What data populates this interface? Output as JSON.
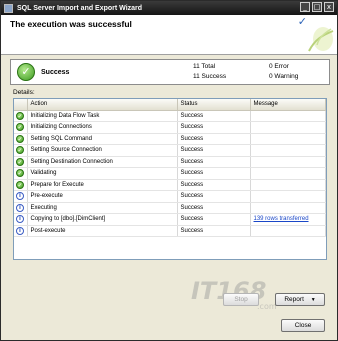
{
  "window": {
    "title": "SQL Server Import and Export Wizard",
    "minimize_glyph": "_",
    "maximize_glyph": "□",
    "close_glyph": "x"
  },
  "header": {
    "heading": "The execution was successful",
    "check_icon": "checkmark-icon",
    "check_glyph": "✓"
  },
  "status": {
    "icon": "success-icon",
    "icon_glyph": "✓",
    "text": "Success",
    "total": "11 Total",
    "success": "11 Success",
    "error": "0 Error",
    "warning": "0 Warning"
  },
  "details": {
    "label": "Details:",
    "columns": {
      "action": "Action",
      "status": "Status",
      "message": "Message"
    },
    "rows": [
      {
        "icon": "success",
        "action": "Initializing Data Flow Task",
        "status": "Success",
        "message": ""
      },
      {
        "icon": "success",
        "action": "Initializing Connections",
        "status": "Success",
        "message": ""
      },
      {
        "icon": "success",
        "action": "Setting SQL Command",
        "status": "Success",
        "message": ""
      },
      {
        "icon": "success",
        "action": "Setting Source Connection",
        "status": "Success",
        "message": ""
      },
      {
        "icon": "success",
        "action": "Setting Destination Connection",
        "status": "Success",
        "message": ""
      },
      {
        "icon": "success",
        "action": "Validating",
        "status": "Success",
        "message": ""
      },
      {
        "icon": "success",
        "action": "Prepare for Execute",
        "status": "Success",
        "message": ""
      },
      {
        "icon": "info",
        "action": "Pre-execute",
        "status": "Success",
        "message": ""
      },
      {
        "icon": "info",
        "action": "Executing",
        "status": "Success",
        "message": ""
      },
      {
        "icon": "info",
        "action": "Copying to [dbo].[DimClient]",
        "status": "Success",
        "message": "139 rows transferred"
      },
      {
        "icon": "info",
        "action": "Post-execute",
        "status": "Success",
        "message": ""
      }
    ],
    "icon_glyphs": {
      "success": "✓",
      "info": "i"
    }
  },
  "buttons": {
    "stop": "Stop",
    "report": "Report",
    "report_arrow": "▼",
    "close": "Close"
  },
  "watermark": {
    "text": "IT168.com"
  },
  "colors": {
    "titlebar": "#1e1e1e",
    "link": "#1a47c8",
    "success": "#3a9a1e",
    "info": "#3a5cc3"
  }
}
